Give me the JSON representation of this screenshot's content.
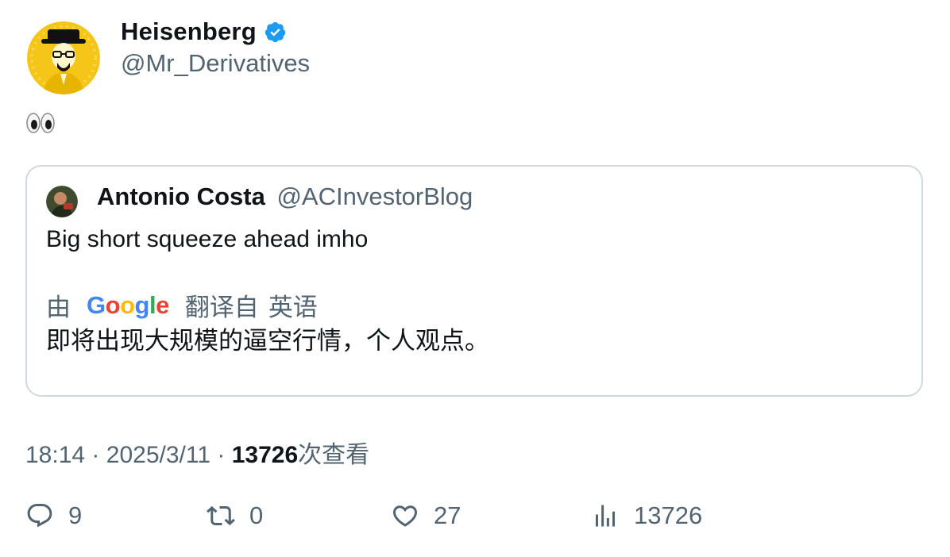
{
  "tweet": {
    "author": {
      "display_name": "Heisenberg",
      "handle": "@Mr_Derivatives",
      "verified_color": "#1d9bf0"
    },
    "text": "👀",
    "quoted": {
      "author_name": "Antonio Costa",
      "author_handle": "@ACInvestorBlog",
      "text": "Big short squeeze ahead imho",
      "translation": {
        "prefix": "由",
        "provider_letters": [
          "G",
          "o",
          "o",
          "g",
          "l",
          "e"
        ],
        "suffix": "翻译自",
        "language": "英语",
        "text": "即将出现大规模的逼空行情，个人观点。"
      }
    },
    "meta": {
      "time": "18:14",
      "separator": "·",
      "date": "2025/3/11",
      "views": "13726",
      "views_label": "次查看"
    },
    "actions": {
      "replies": "9",
      "retweets": "0",
      "likes": "27",
      "views": "13726"
    }
  }
}
